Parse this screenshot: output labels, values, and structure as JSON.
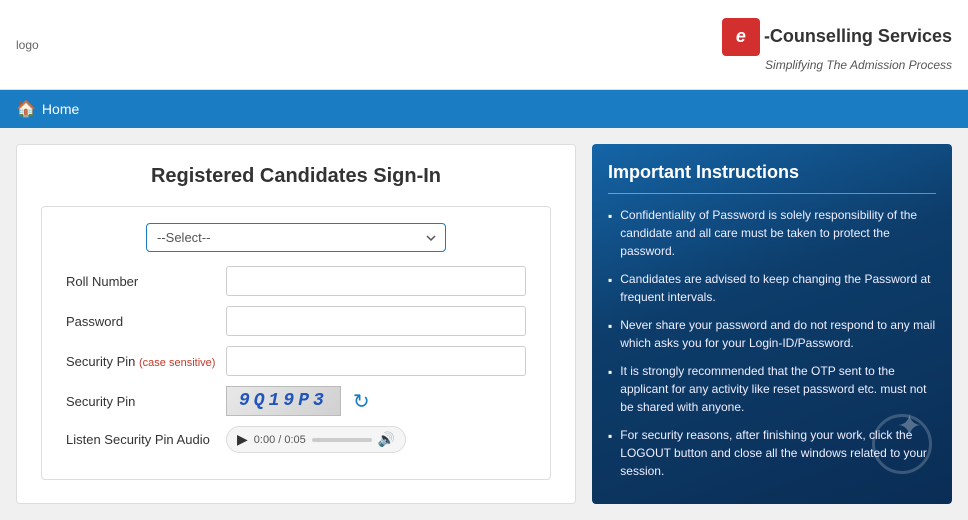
{
  "header": {
    "logo_text": "logo",
    "brand_icon": "e",
    "brand_name": "-Counselling Services",
    "brand_tagline": "Simplifying The Admission Process"
  },
  "nav": {
    "home_label": "Home",
    "home_icon": "🏠"
  },
  "form": {
    "title": "Registered Candidates Sign-In",
    "select_placeholder": "--Select--",
    "roll_number_label": "Roll Number",
    "password_label": "Password",
    "security_pin_label": "Security Pin",
    "security_pin_note": "(case sensitive)",
    "security_pin_row_label": "Security Pin",
    "captcha_text": "9Q19P3",
    "audio_label": "Listen Security Pin Audio",
    "audio_time": "0:00 / 0:05",
    "play_icon": "▶",
    "volume_icon": "🔊",
    "refresh_icon": "↻"
  },
  "instructions": {
    "title": "Important Instructions",
    "items": [
      "Confidentiality of Password is solely responsibility of the candidate and all care must be taken to protect the password.",
      "Candidates are advised to keep changing the Password at frequent intervals.",
      "Never share your password and do not respond to any mail which asks you for your Login-ID/Password.",
      "It is strongly recommended that the OTP sent to the applicant for any activity like reset password etc. must not be shared with anyone.",
      "For security reasons, after finishing your work, click the LOGOUT button and close all the windows related to your session."
    ]
  }
}
